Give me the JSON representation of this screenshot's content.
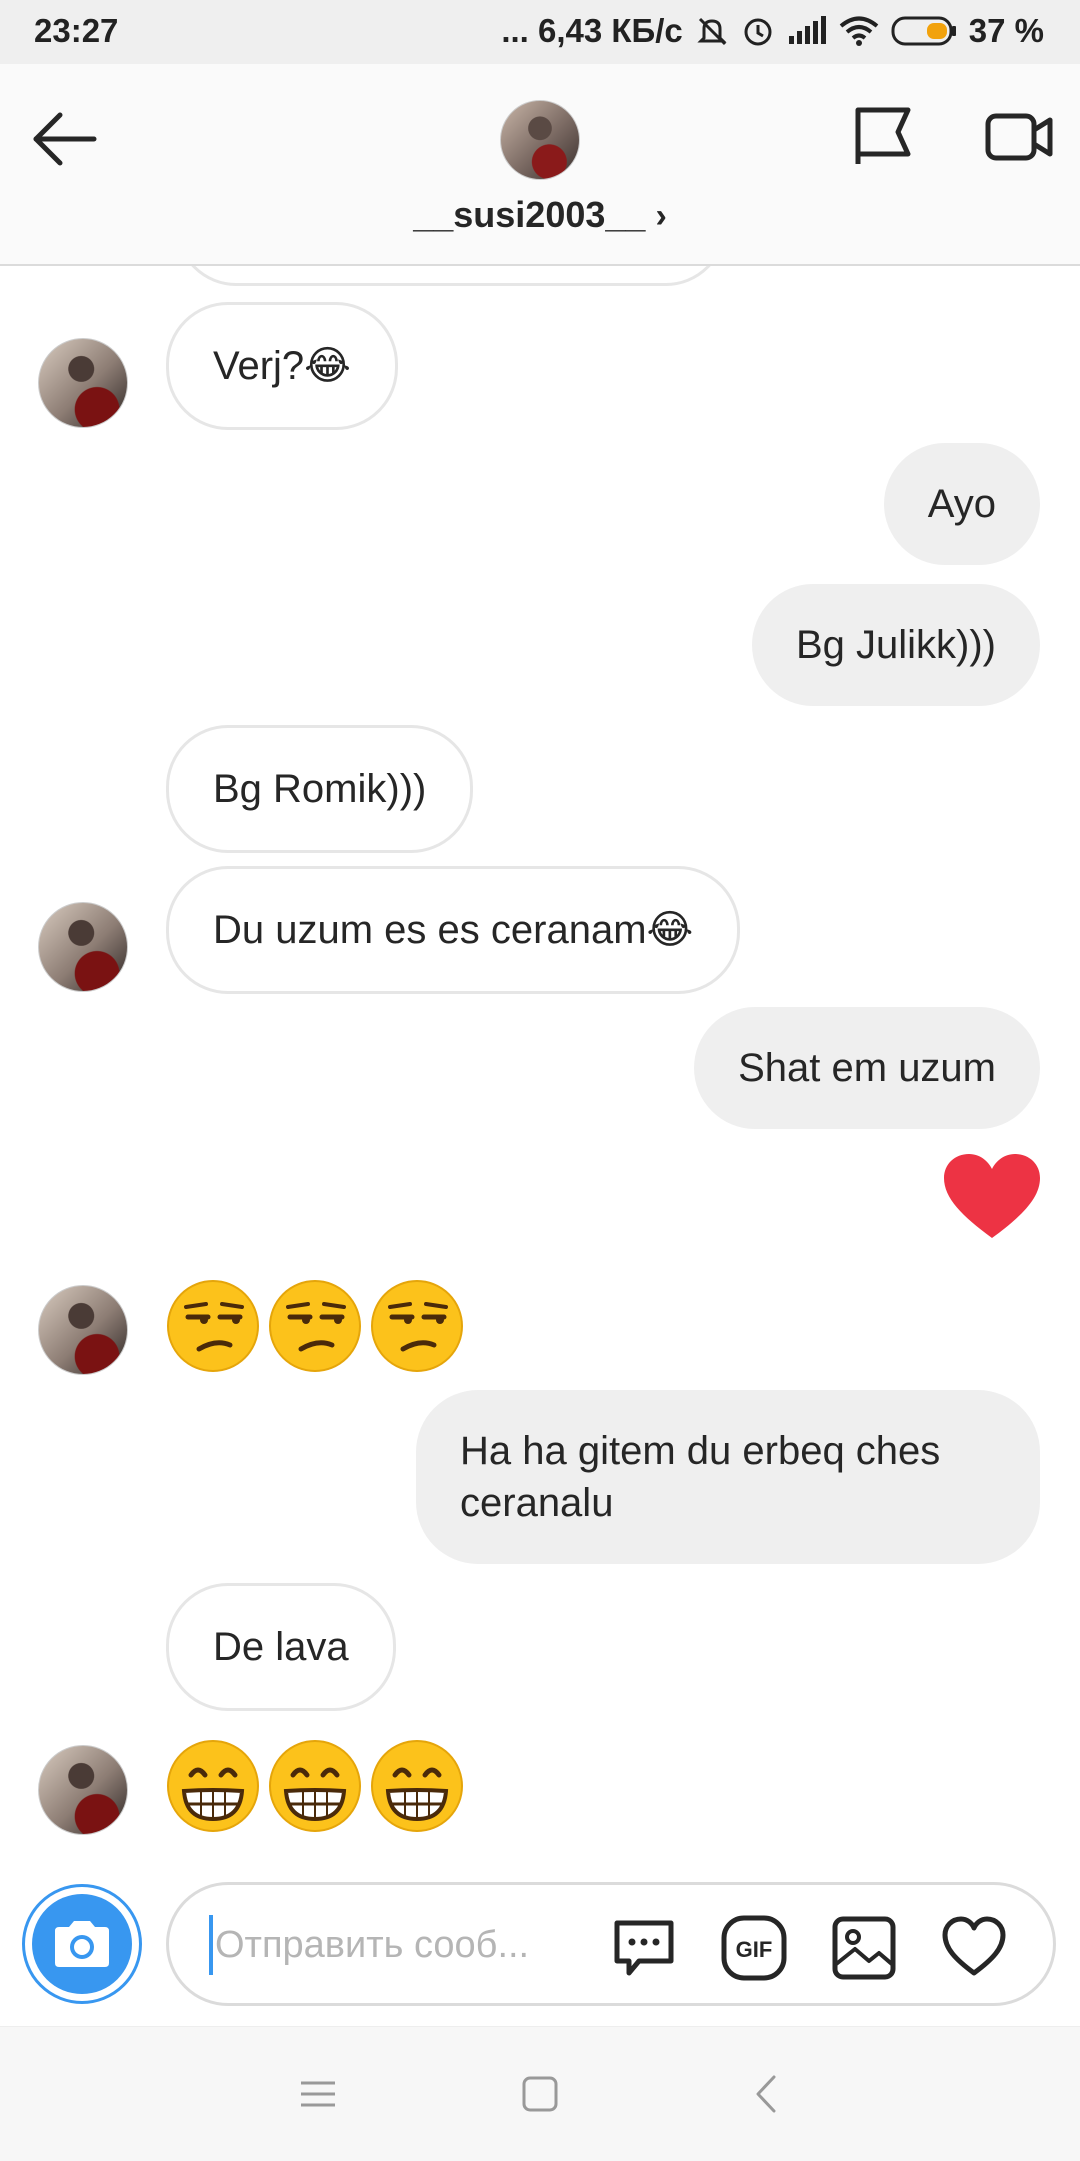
{
  "status_bar": {
    "time": "23:27",
    "network_speed": "... 6,43 КБ/с",
    "battery": "37 %"
  },
  "header": {
    "username": "__susi2003__",
    "chevron": "›"
  },
  "messages": [
    {
      "side": "in",
      "text": "Verj?😂"
    },
    {
      "side": "out",
      "text": "Ayo"
    },
    {
      "side": "out",
      "text": "Bg Julikk)))"
    },
    {
      "side": "in",
      "text": "Bg Romik)))"
    },
    {
      "side": "in",
      "text": "Du uzum es es ceranam😂"
    },
    {
      "side": "out",
      "text": "Shat em uzum"
    },
    {
      "side": "out",
      "kind": "heart"
    },
    {
      "side": "in",
      "kind": "emoji",
      "emoji": "unamused-face",
      "count": 3
    },
    {
      "side": "out",
      "text": "Ha ha gitem du erbeq ches ceranalu"
    },
    {
      "side": "in",
      "text": "De lava"
    },
    {
      "side": "in",
      "kind": "emoji",
      "emoji": "grinning-face",
      "count": 3
    }
  ],
  "composer": {
    "placeholder": "Отправить сооб..."
  },
  "icons": {
    "back": "arrow-left-icon",
    "flag": "flag-icon",
    "video": "video-camera-icon",
    "camera": "camera-icon",
    "chat": "chat-bubble-icon",
    "gif": "gif-icon",
    "gallery": "image-icon",
    "like": "heart-icon"
  },
  "colors": {
    "accent": "#3897f0",
    "heart": "#ed3344",
    "incoming_border": "#e6e6e6",
    "outgoing_bg": "#efefef"
  }
}
